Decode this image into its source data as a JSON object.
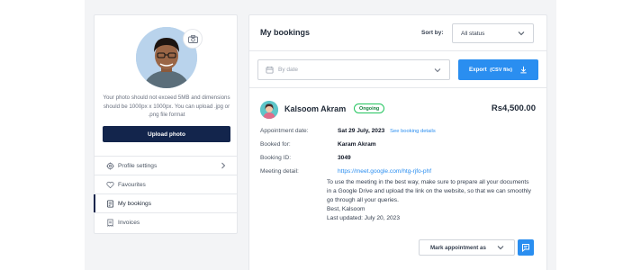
{
  "profile": {
    "photo_note": "Your photo should not exceed 5MB and dimensions should be 1000px x 1000px. You can upload .jpg or .png file format",
    "upload_label": "Upload photo",
    "menu": [
      {
        "label": "Profile settings",
        "icon": "gear-icon"
      },
      {
        "label": "Favourites",
        "icon": "heart-icon"
      },
      {
        "label": "My bookings",
        "icon": "bookings-icon",
        "active": true
      },
      {
        "label": "Invoices",
        "icon": "invoice-icon"
      }
    ]
  },
  "bookings": {
    "title": "My bookings",
    "sort_label": "Sort by:",
    "status_value": "All status",
    "date_placeholder": "By date",
    "export_label": "Export",
    "export_suffix": "(CSV file)",
    "item": {
      "name": "Kalsoom Akram",
      "status": "Ongoing",
      "price": "Rs4,500.00",
      "appointment_label": "Appointment date:",
      "appointment_value": "Sat 29 July, 2023",
      "see_details": "See booking details",
      "booked_for_label": "Booked for:",
      "booked_for_value": "Karam Akram",
      "booking_id_label": "Booking ID:",
      "booking_id_value": "3049",
      "meeting_label": "Meeting detail:",
      "meeting_link": "https://meet.google.com/htg-rjfo-phf",
      "description": "To use the meeting in the best way, make sure to prepare all your documents in a Google Drive and upload the link on the website, so that we can smoothly go through all your queries.",
      "signoff": "Best, Kalsoom",
      "last_updated": "Last updated: July 20, 2023",
      "mark_label": "Mark appointment as"
    }
  },
  "colors": {
    "primary_dark": "#13254c",
    "accent_blue": "#2a8ef0",
    "badge_green": "#22c55e"
  }
}
